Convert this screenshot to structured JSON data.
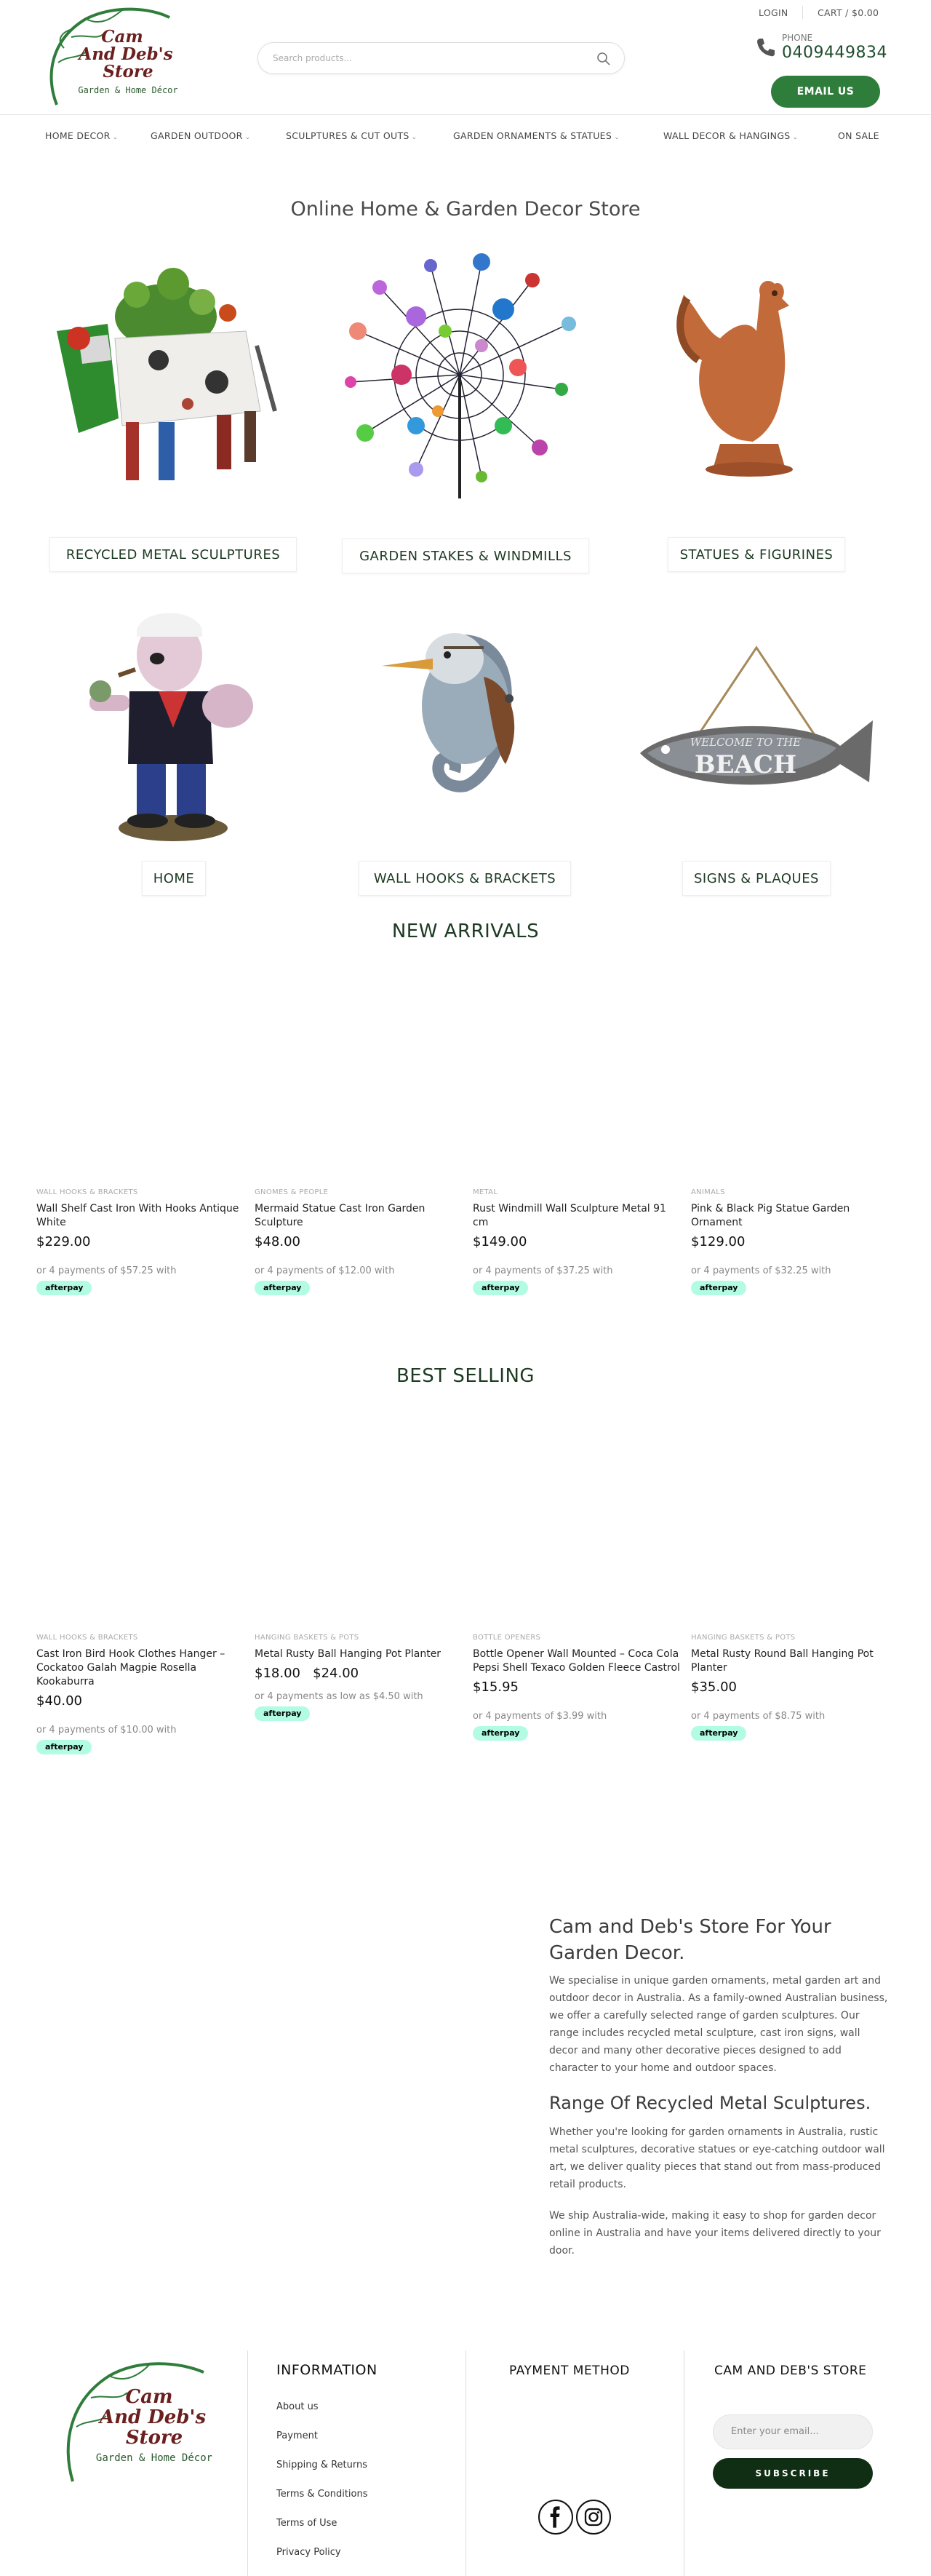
{
  "header": {
    "brand_line1": "Cam",
    "brand_line2": "And Deb's",
    "brand_line3": "Store",
    "brand_tagline": "Garden & Home Décor",
    "search_placeholder": "Search products...",
    "login_label": "LOGIN",
    "cart_label": "CART / $0.00",
    "phone_label": "PHONE",
    "phone_number": "0409449834",
    "email_button": "EMAIL US"
  },
  "nav": {
    "items": [
      {
        "label": "HOME DECOR",
        "has_dropdown": true
      },
      {
        "label": "GARDEN OUTDOOR",
        "has_dropdown": true
      },
      {
        "label": "SCULPTURES & CUT OUTS",
        "has_dropdown": true
      },
      {
        "label": "GARDEN ORNAMENTS & STATUES",
        "has_dropdown": true
      },
      {
        "label": "WALL DECOR & HANGINGS",
        "has_dropdown": true
      },
      {
        "label": "ON SALE",
        "has_dropdown": false
      }
    ]
  },
  "hero": {
    "title": "Online Home & Garden Decor Store"
  },
  "categories": [
    {
      "label": "RECYCLED METAL SCULPTURES",
      "icon": "metal-cow-planter-image"
    },
    {
      "label": "GARDEN STAKES & WINDMILLS",
      "icon": "wind-spinner-image"
    },
    {
      "label": "STATUES & FIGURINES",
      "icon": "rooster-statue-image"
    },
    {
      "label": "HOME",
      "icon": "popeye-figurine-image"
    },
    {
      "label": "WALL HOOKS & BRACKETS",
      "icon": "kookaburra-hook-image"
    },
    {
      "label": "SIGNS & PLAQUES",
      "icon": "beach-fish-sign-image",
      "sign_text_1": "WELCOME TO THE",
      "sign_text_2": "BEACH"
    }
  ],
  "new_arrivals": {
    "title": "NEW ARRIVALS",
    "products": [
      {
        "category": "WALL HOOKS & BRACKETS",
        "name": "Wall Shelf Cast Iron With Hooks Antique White",
        "price": "$229.00",
        "payments": "or 4 payments of $57.25 with",
        "badge": "afterpay"
      },
      {
        "category": "GNOMES & PEOPLE",
        "name": "Mermaid Statue Cast Iron Garden Sculpture",
        "price": "$48.00",
        "payments": "or 4 payments of $12.00 with",
        "badge": "afterpay"
      },
      {
        "category": "METAL",
        "name": "Rust Windmill Wall Sculpture Metal 91 cm",
        "price": "$149.00",
        "payments": "or 4 payments of $37.25 with",
        "badge": "afterpay"
      },
      {
        "category": "ANIMALS",
        "name": "Pink & Black Pig Statue Garden Ornament",
        "price": "$129.00",
        "payments": "or 4 payments of $32.25 with",
        "badge": "afterpay"
      }
    ]
  },
  "best_selling": {
    "title": "BEST SELLING",
    "products": [
      {
        "category": "WALL HOOKS & BRACKETS",
        "name": "Cast Iron Bird Hook Clothes Hanger – Cockatoo Galah Magpie Rosella Kookaburra",
        "price": "$40.00",
        "payments": "or 4 payments of $10.00 with",
        "badge": "afterpay"
      },
      {
        "category": "HANGING BASKETS & POTS",
        "name": "Metal Rusty Ball Hanging Pot Planter",
        "price_old": "$18.00",
        "price": "$24.00",
        "payments": "or 4 payments as low as $4.50 with",
        "badge": "afterpay"
      },
      {
        "category": "BOTTLE OPENERS",
        "name": "Bottle Opener Wall Mounted – Coca Cola Pepsi Shell Texaco Golden Fleece Castrol",
        "price": "$15.95",
        "payments": "or 4 payments of $3.99 with",
        "badge": "afterpay"
      },
      {
        "category": "HANGING BASKETS & POTS",
        "name": "Metal Rusty Round Ball Hanging Pot Planter",
        "price": "$35.00",
        "payments": "or 4 payments of $8.75 with",
        "badge": "afterpay"
      }
    ]
  },
  "about": {
    "heading1_line1": "Cam and Deb's Store For Your",
    "heading1_line2": "Garden Decor.",
    "para1": "We specialise in unique garden ornaments, metal garden art and outdoor decor in Australia. As a family-owned Australian business, we offer a carefully selected range of garden sculptures. Our range includes recycled metal sculpture, cast iron signs, wall decor and many other decorative pieces designed to add character to your home and outdoor spaces.",
    "heading2": "Range Of Recycled Metal Sculptures.",
    "para2": "Whether you're looking for garden ornaments in Australia, rustic metal sculptures, decorative statues or eye-catching outdoor wall art, we deliver quality pieces that stand out from mass-produced retail products.",
    "para3": "We ship Australia-wide, making it easy to shop for garden decor online in Australia and have your items delivered directly to your door."
  },
  "footer": {
    "brand_line1": "Cam",
    "brand_line2": "And Deb's",
    "brand_line3": "Store",
    "brand_tagline": "Garden & Home Décor",
    "info_title": "INFORMATION",
    "links": [
      "About us",
      "Payment",
      "Shipping & Returns",
      "Terms & Conditions",
      "Terms of Use",
      "Privacy Policy"
    ],
    "payment_title": "PAYMENT METHOD",
    "store_title": "CAM AND DEB'S STORE",
    "email_placeholder": "Enter your email...",
    "subscribe_label": "SUBSCRIBE",
    "social_icons": [
      "facebook-icon",
      "instagram-icon"
    ]
  },
  "colors": {
    "brand_green": "#2f7d3b",
    "dark_green": "#0f2e14",
    "logo_brown": "#6b1f1f",
    "afterpay_mint": "#b2fce4"
  }
}
